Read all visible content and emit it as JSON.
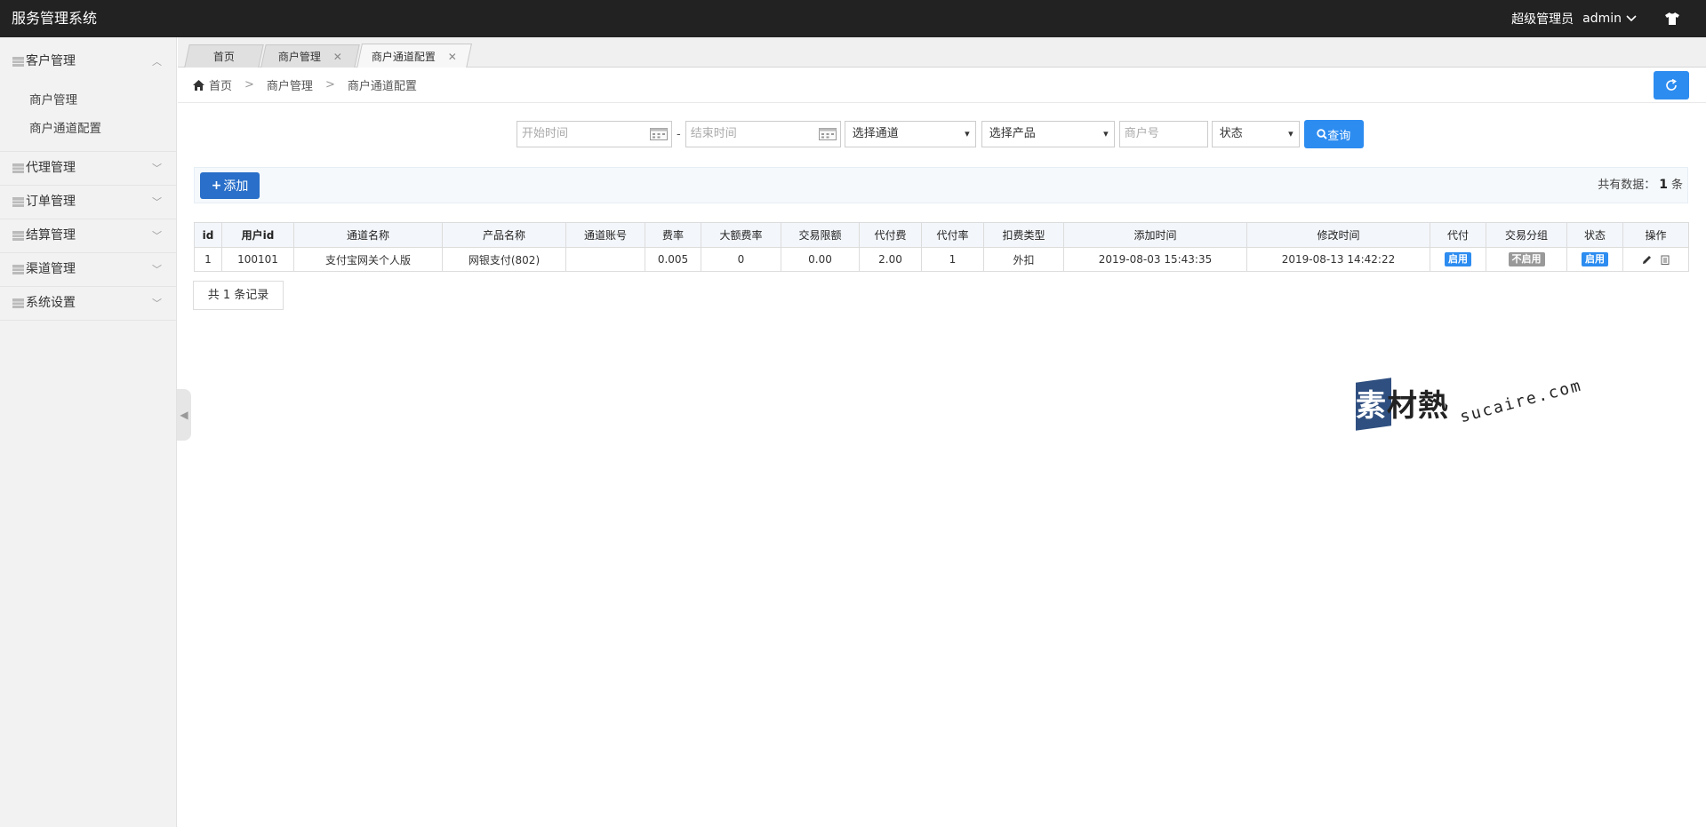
{
  "app": {
    "title": "服务管理系统",
    "role": "超级管理员",
    "username": "admin"
  },
  "sidebar": {
    "groups": [
      {
        "label": "客户管理",
        "expanded": true,
        "items": [
          {
            "label": "商户管理"
          },
          {
            "label": "商户通道配置"
          }
        ]
      },
      {
        "label": "代理管理",
        "expanded": false
      },
      {
        "label": "订单管理",
        "expanded": false
      },
      {
        "label": "结算管理",
        "expanded": false
      },
      {
        "label": "渠道管理",
        "expanded": false
      },
      {
        "label": "系统设置",
        "expanded": false
      }
    ]
  },
  "tabs": [
    {
      "label": "首页",
      "closable": false,
      "active": false
    },
    {
      "label": "商户管理",
      "closable": true,
      "active": false
    },
    {
      "label": "商户通道配置",
      "closable": true,
      "active": true
    }
  ],
  "breadcrumb": [
    "首页",
    "商户管理",
    "商户通道配置"
  ],
  "filters": {
    "start_time_placeholder": "开始时间",
    "end_time_placeholder": "结束时间",
    "dash": "-",
    "channel_select": "选择通道",
    "product_select": "选择产品",
    "merchant_placeholder": "商户号",
    "status_select": "状态",
    "query_label": "查询"
  },
  "toolbar": {
    "add_label": "添加",
    "total_prefix": "共有数据：",
    "total_count": "1",
    "total_suffix": "条"
  },
  "table": {
    "headers": [
      "id",
      "用户id",
      "通道名称",
      "产品名称",
      "通道账号",
      "费率",
      "大额费率",
      "交易限额",
      "代付费",
      "代付率",
      "扣费类型",
      "添加时间",
      "修改时间",
      "代付",
      "交易分组",
      "状态",
      "操作"
    ],
    "rows": [
      {
        "id": "1",
        "user_id": "100101",
        "channel_name": "支付宝网关个人版",
        "product_name": "网银支付(802)",
        "channel_account": "",
        "rate": "0.005",
        "large_rate": "0",
        "trade_limit": "0.00",
        "payout_fee": "2.00",
        "payout_rate": "1",
        "fee_type": "外扣",
        "created_at": "2019-08-03 15:43:35",
        "updated_at": "2019-08-13 14:42:22",
        "payout_badge": "启用",
        "group_badge": "不启用",
        "status_badge": "启用"
      }
    ]
  },
  "pagination": {
    "record_text": "共 1 条记录"
  },
  "watermark": {
    "cn": "素材熱",
    "en": "sucaire.com"
  },
  "colors": {
    "topbar": "#222222",
    "primary": "#2d8cf0",
    "add_button": "#2a6fc9",
    "badge_on": "#2d8cf0",
    "badge_off": "#999999"
  }
}
